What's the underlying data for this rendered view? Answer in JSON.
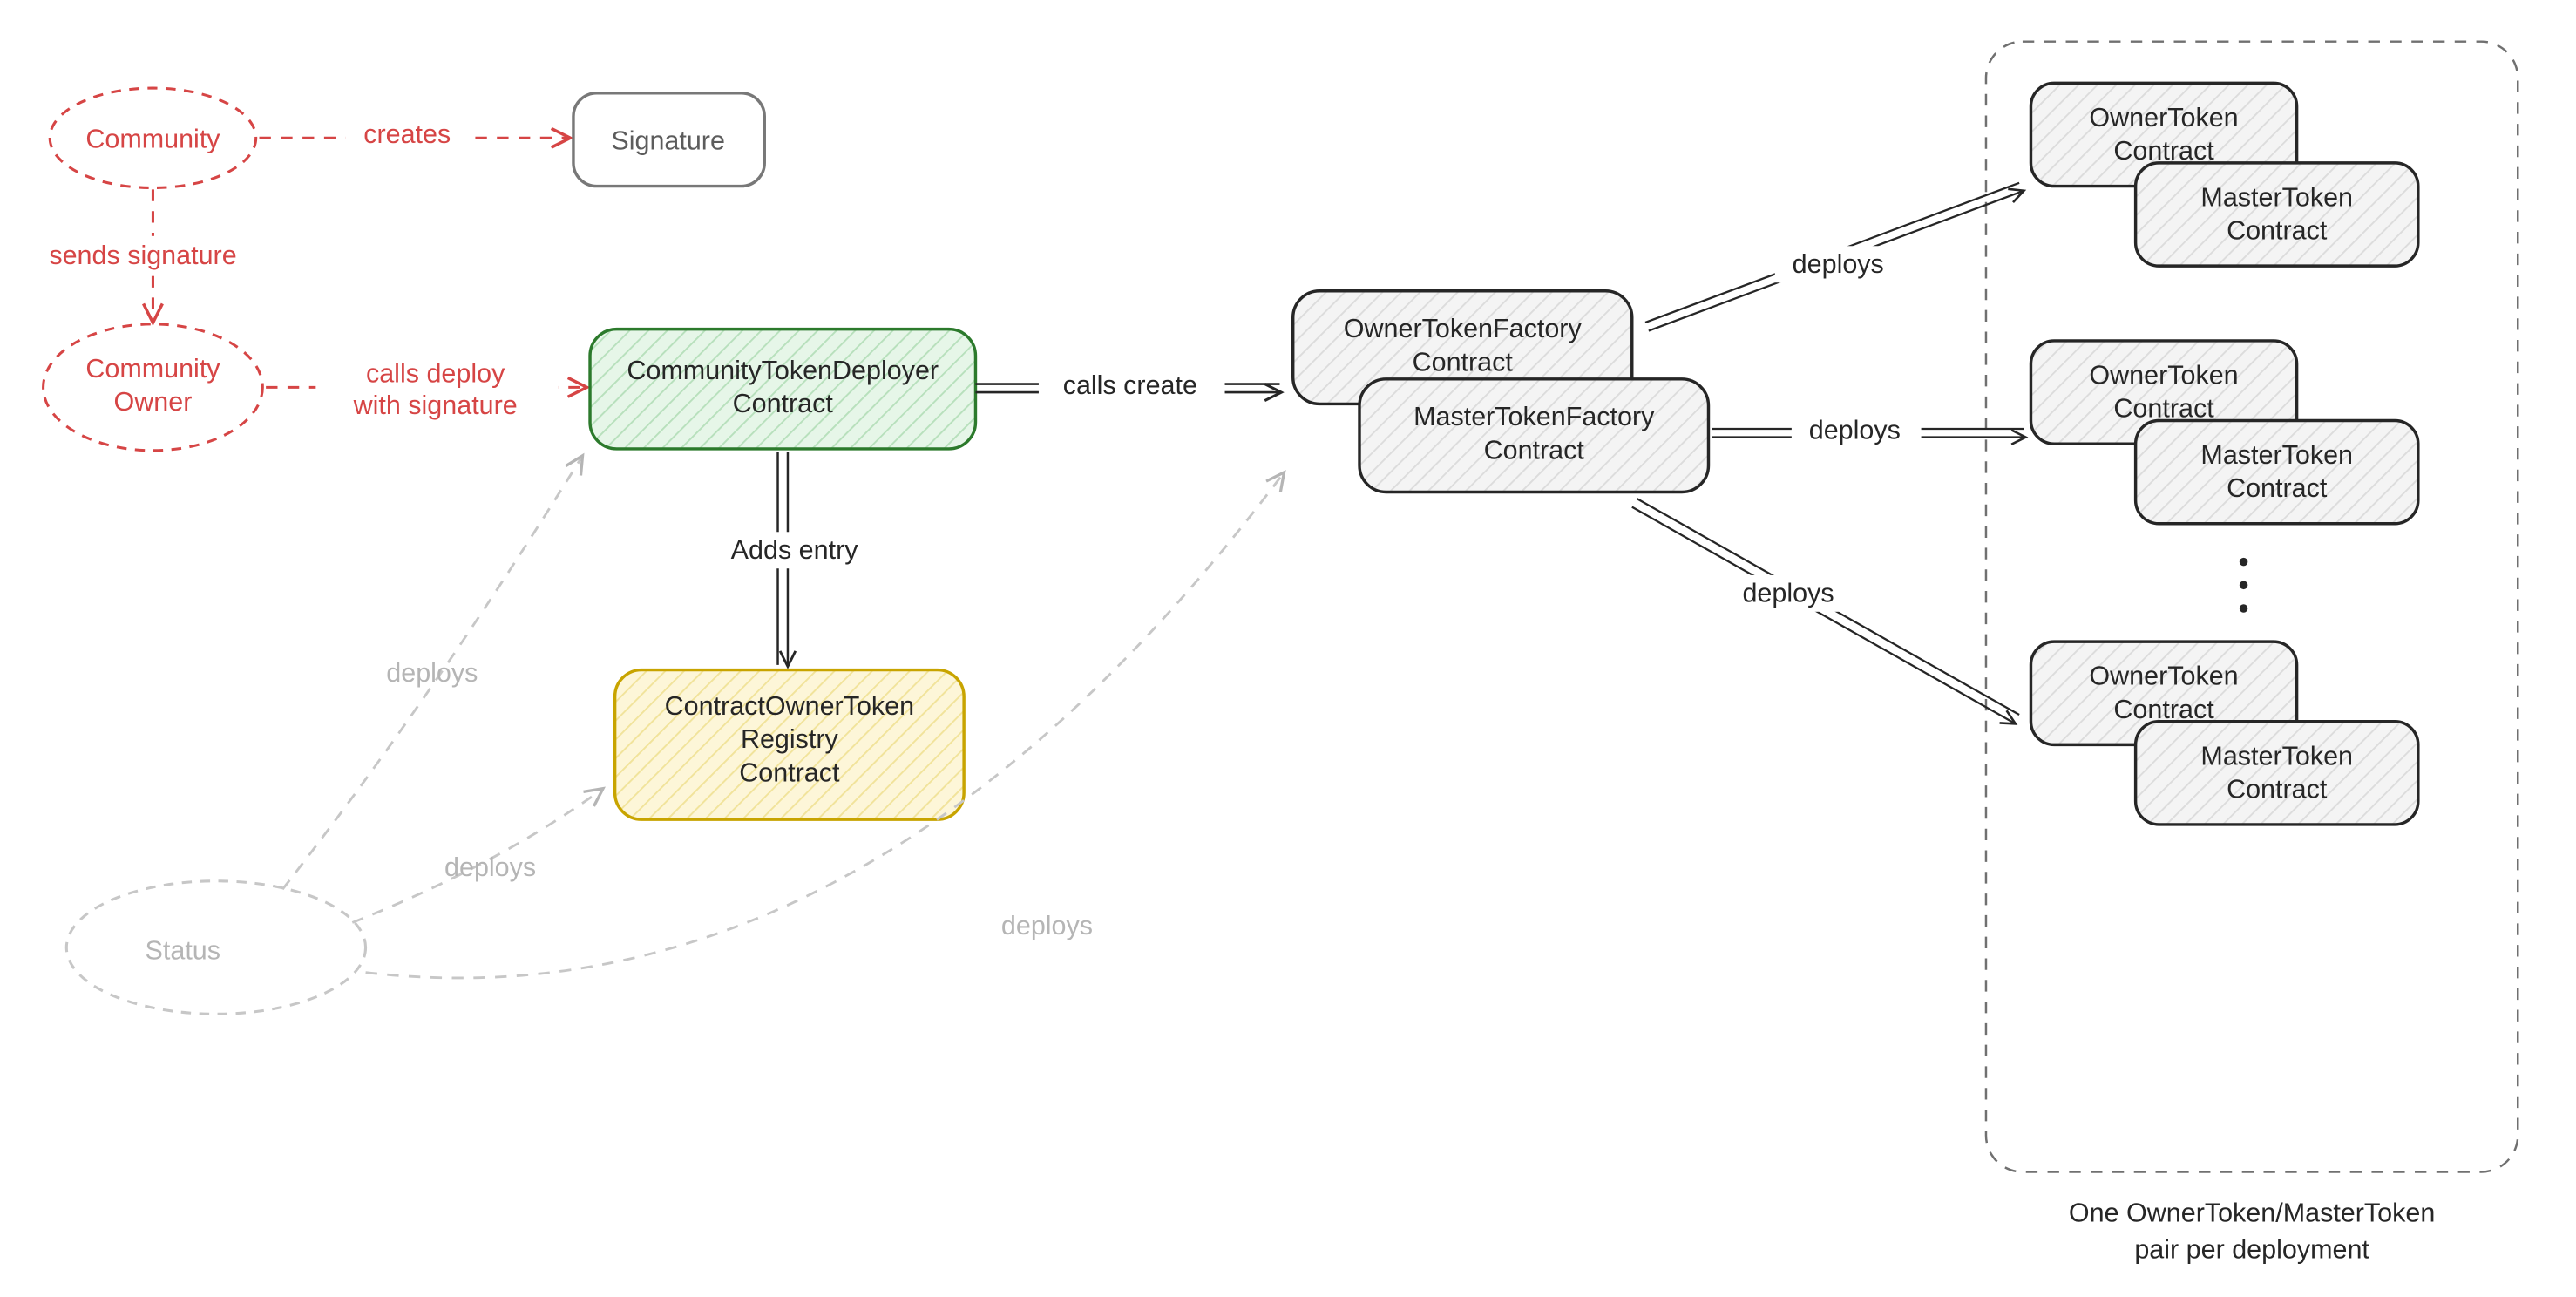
{
  "nodes": {
    "community": {
      "label": "Community"
    },
    "signature": {
      "label": "Signature"
    },
    "community_owner": {
      "line1": "Community",
      "line2": "Owner"
    },
    "deployer": {
      "line1": "CommunityTokenDeployer",
      "line2": "Contract"
    },
    "registry": {
      "line1": "ContractOwnerToken",
      "line2": "Registry",
      "line3": "Contract"
    },
    "owner_factory": {
      "line1": "OwnerTokenFactory",
      "line2": "Contract"
    },
    "master_factory": {
      "line1": "MasterTokenFactory",
      "line2": "Contract"
    },
    "owner_token": {
      "line1": "OwnerToken",
      "line2": "Contract"
    },
    "master_token": {
      "line1": "MasterToken",
      "line2": "Contract"
    },
    "status": {
      "label": "Status"
    }
  },
  "edges": {
    "creates": "creates",
    "sends_signature": "sends signature",
    "calls_deploy_1": "calls deploy",
    "calls_deploy_2": "with signature",
    "adds_entry": "Adds entry",
    "calls_create": "calls create",
    "deploys": "deploys"
  },
  "group_caption": {
    "line1": "One OwnerToken/MasterToken",
    "line2": "pair per deployment"
  },
  "colors": {
    "red": "#d64545",
    "grey": "#5c5c5c",
    "light": "#b5b5b5",
    "black": "#262626",
    "greenFill": "#d9f0dc",
    "greenStroke": "#2c7a2c",
    "yellowFill": "#fdf3cf",
    "yellowStroke": "#c8a400",
    "hatch": "#e8e8e8"
  }
}
